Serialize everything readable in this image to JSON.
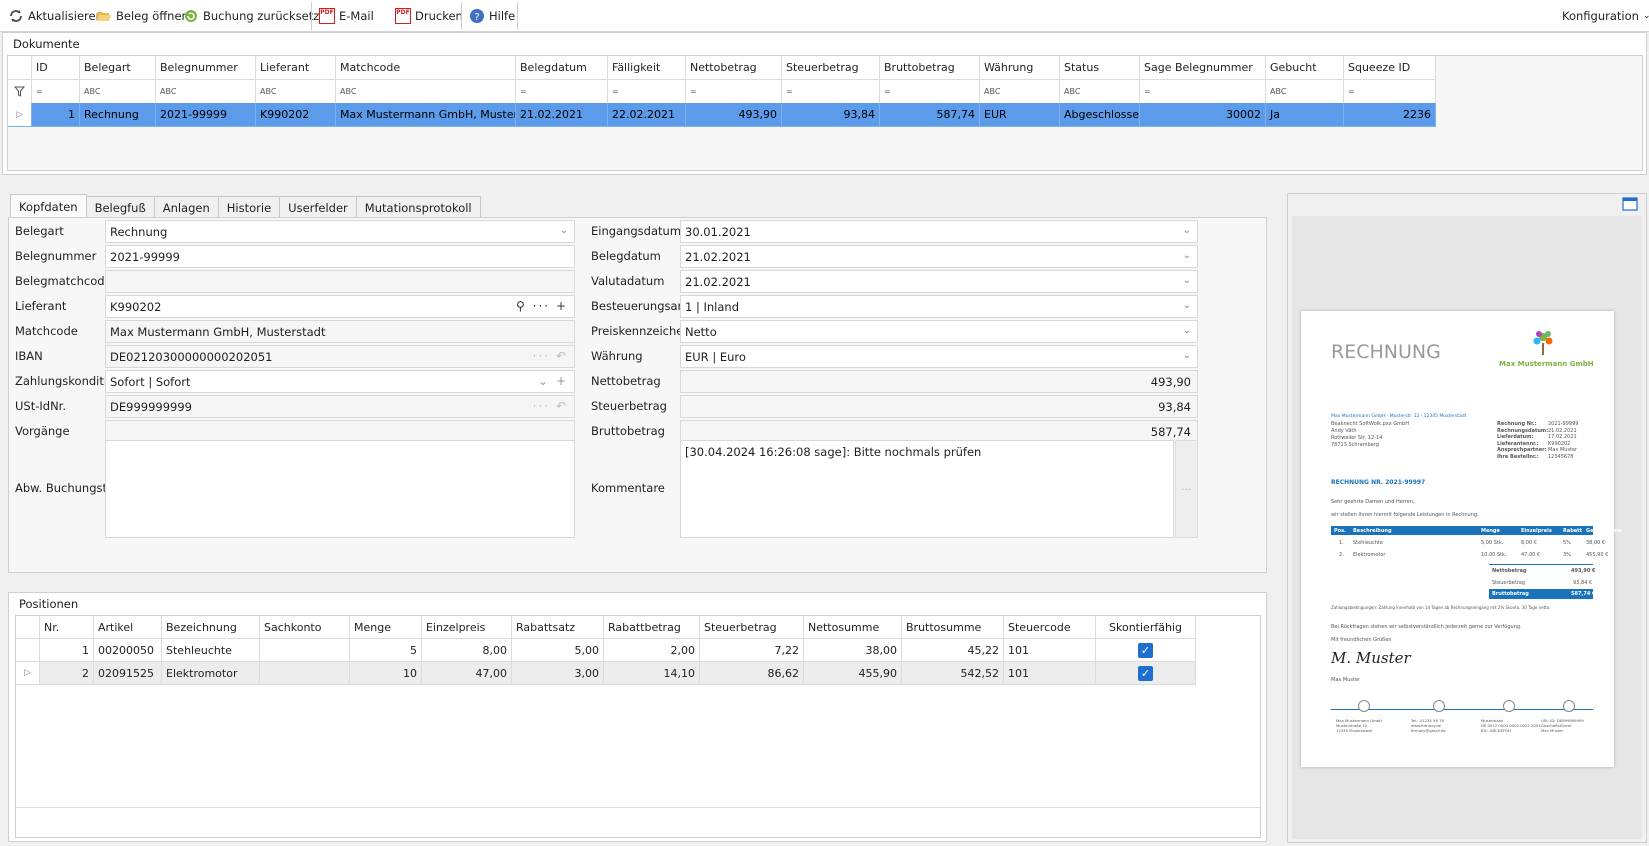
{
  "toolbar": {
    "refresh": "Aktualisieren",
    "open_doc": "Beleg öffnen",
    "reset_booking": "Buchung zurücksetzen",
    "email": "E-Mail",
    "print": "Drucken",
    "help": "Hilfe",
    "config": "Konfiguration",
    "pdf_badge": "PDF"
  },
  "documents": {
    "title": "Dokumente",
    "columns": [
      "ID",
      "Belegart",
      "Belegnummer",
      "Lieferant",
      "Matchcode",
      "Belegdatum",
      "Fälligkeit",
      "Nettobetrag",
      "Steuerbetrag",
      "Bruttobetrag",
      "Währung",
      "Status",
      "Sage Belegnummer",
      "Gebucht",
      "Squeeze ID"
    ],
    "filters": [
      "=",
      "ABC",
      "ABC",
      "ABC",
      "ABC",
      "=",
      "=",
      "=",
      "=",
      "=",
      "ABC",
      "ABC",
      "=",
      "ABC",
      "="
    ],
    "rows": [
      [
        "1",
        "Rechnung",
        "2021-99999",
        "K990202",
        "Max Mustermann GmbH, Musterstadt",
        "21.02.2021",
        "22.02.2021",
        "493,90",
        "93,84",
        "587,74",
        "EUR",
        "Abgeschlossen",
        "30002",
        "Ja",
        "2236"
      ]
    ]
  },
  "tabs": [
    "Kopfdaten",
    "Belegfuß",
    "Anlagen",
    "Historie",
    "Userfelder",
    "Mutationsprotokoll"
  ],
  "head": {
    "left": [
      {
        "label": "Belegart",
        "value": "Rechnung"
      },
      {
        "label": "Belegnummer",
        "value": "2021-99999"
      },
      {
        "label": "Belegmatchcode",
        "value": ""
      },
      {
        "label": "Lieferant",
        "value": "K990202"
      },
      {
        "label": "Matchcode",
        "value": "Max Mustermann GmbH, Musterstadt"
      },
      {
        "label": "IBAN",
        "value": "DE02120300000000202051"
      },
      {
        "label": "Zahlungskondition",
        "value": "Sofort | Sofort"
      },
      {
        "label": "USt-IdNr.",
        "value": "DE999999999"
      },
      {
        "label": "Vorgänge",
        "value": ""
      },
      {
        "label": "Abw. Buchungstext",
        "value": ""
      }
    ],
    "right": [
      {
        "label": "Eingangsdatum",
        "value": "30.01.2021"
      },
      {
        "label": "Belegdatum",
        "value": "21.02.2021"
      },
      {
        "label": "Valutadatum",
        "value": "21.02.2021"
      },
      {
        "label": "Besteuerungsart",
        "value": "1 | Inland"
      },
      {
        "label": "Preiskennzeichen",
        "value": "Netto"
      },
      {
        "label": "Währung",
        "value": "EUR | Euro"
      },
      {
        "label": "Nettobetrag",
        "value": "493,90"
      },
      {
        "label": "Steuerbetrag",
        "value": "93,84"
      },
      {
        "label": "Bruttobetrag",
        "value": "587,74"
      },
      {
        "label": "Kommentare",
        "value": "[30.04.2024 16:26:08 sage]: Bitte nochmals prüfen"
      }
    ],
    "more": "···"
  },
  "positions": {
    "title": "Positionen",
    "columns": [
      "Nr.",
      "Artikel",
      "Bezeichnung",
      "Sachkonto",
      "Menge",
      "Einzelpreis",
      "Rabattsatz",
      "Rabattbetrag",
      "Steuerbetrag",
      "Nettosumme",
      "Bruttosumme",
      "Steuercode",
      "Skontierfähig"
    ],
    "rows": [
      [
        "1",
        "00200050",
        "Stehleuchte",
        "",
        "5",
        "8,00",
        "5,00",
        "2,00",
        "7,22",
        "38,00",
        "45,22",
        "101"
      ],
      [
        "2",
        "02091525",
        "Elektromotor",
        "",
        "10",
        "47,00",
        "3,00",
        "14,10",
        "86,62",
        "455,90",
        "542,52",
        "101"
      ]
    ]
  },
  "invoice": {
    "title": "RECHNUNG",
    "brand": "Max Mustermann GmbH",
    "sender_line": "Max Mustermann GmbH · Musterstr. 12 · 12345 Musterstadt",
    "addr": [
      "Beaknecht SoftWolk.pxx GmbH",
      "Andy Väth",
      "Rottweiler Str. 12-14",
      "78713 Schramberg"
    ],
    "meta": [
      [
        "Rechnung Nr.:",
        "2021-99999"
      ],
      [
        "Rechnungsdatum:",
        "21.02.2021"
      ],
      [
        "Lieferdatum:",
        "17.02.2021"
      ],
      [
        "Lieferantennr.:",
        "K990202"
      ],
      [
        "Ansprechpartner:",
        "Max Muster"
      ],
      [
        "Ihre Bestellnr.:",
        "12345678"
      ]
    ],
    "heading": "RECHNUNG NR. 2021-99997",
    "greeting": "Sehr geehrte Damen und Herren,",
    "intro": "wir stellen Ihnen hiermit folgende Leistungen in Rechnung:",
    "table_head": [
      "Pos.",
      "Beschreibung",
      "Menge",
      "Einzelpreis",
      "Rabatt",
      "Gesamtpreis"
    ],
    "table_rows": [
      [
        "1.",
        "Stehleuchte",
        "5,00 Stk.",
        "8,00 €",
        "5%",
        "38,00 €"
      ],
      [
        "2.",
        "Elektromotor",
        "10,00 Stk.",
        "47,00 €",
        "3%",
        "455,90 €"
      ]
    ],
    "netto": [
      "Nettobetrag",
      "493,90 €"
    ],
    "steuer": [
      "Steuerbetrag",
      "93,84 €"
    ],
    "brutto": [
      "Bruttobetrag",
      "587,74 €"
    ],
    "terms": "Zahlungsbedingungen: Zahlung innerhalb von 14 Tagen ab Rechnungseingang mit 2% Skonto, 30 Tage netto.",
    "closing": "Bei Rückfragen stehen wir selbstverständlich jederzeit gerne zur Verfügung.",
    "regards": "Mit freundlichen Grüßen",
    "signer": "Max Muster",
    "signature": "M. Muster",
    "footer": [
      [
        "Max Mustermann GmbH",
        "Musterstraße 12",
        "12345 Musterstadt"
      ],
      [
        "Tel.: 01234 56 78",
        "www.firmaxy.de",
        "firmaxy@gmail.de"
      ],
      [
        "Musterbank",
        "DE 0012 0000 0000 0022 2051",
        "BIC: ABCDEFGH"
      ],
      [
        "USt.-ID: DE999999999",
        "Geschäftsführer:",
        "Max Muster"
      ]
    ],
    "colors": {
      "accent": "#1a73b8",
      "brand": "#7cb342"
    }
  },
  "colors": {
    "selection": "#5b9bea",
    "checkbox": "#1f6fd1"
  }
}
